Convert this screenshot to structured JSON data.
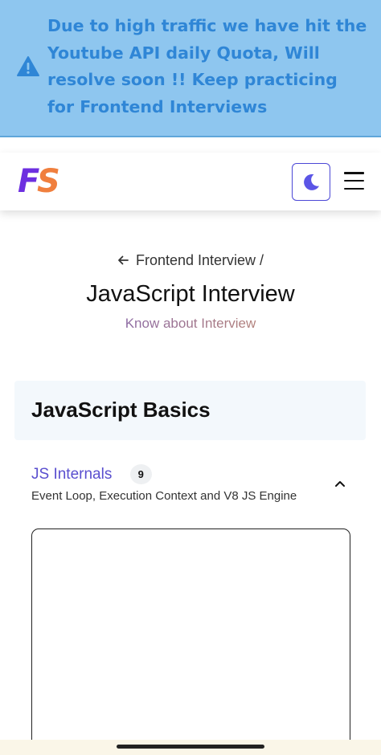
{
  "banner": {
    "icon": "warning-icon",
    "message": "Due to high traffic we have hit the Youtube API daily Quota, Will resolve soon !! Keep practicing for Frontend Interviews",
    "text_color": "#2f86d6",
    "background": "#8ec6ef"
  },
  "header": {
    "logo_f": "F",
    "logo_s": "S",
    "theme_toggle_icon": "moon-icon",
    "menu_icon": "hamburger-menu-icon",
    "accent": "#4b47d6"
  },
  "breadcrumb": {
    "back_icon": "arrow-left-icon",
    "text": "Frontend Interview /"
  },
  "page": {
    "title": "JavaScript Interview",
    "subtitle": "Know about Interview"
  },
  "section": {
    "title": "JavaScript Basics"
  },
  "topic": {
    "title": "JS Internals",
    "count": "9",
    "description": "Event Loop, Execution Context and V8 JS Engine",
    "toggle_icon": "chevron-up-icon"
  }
}
